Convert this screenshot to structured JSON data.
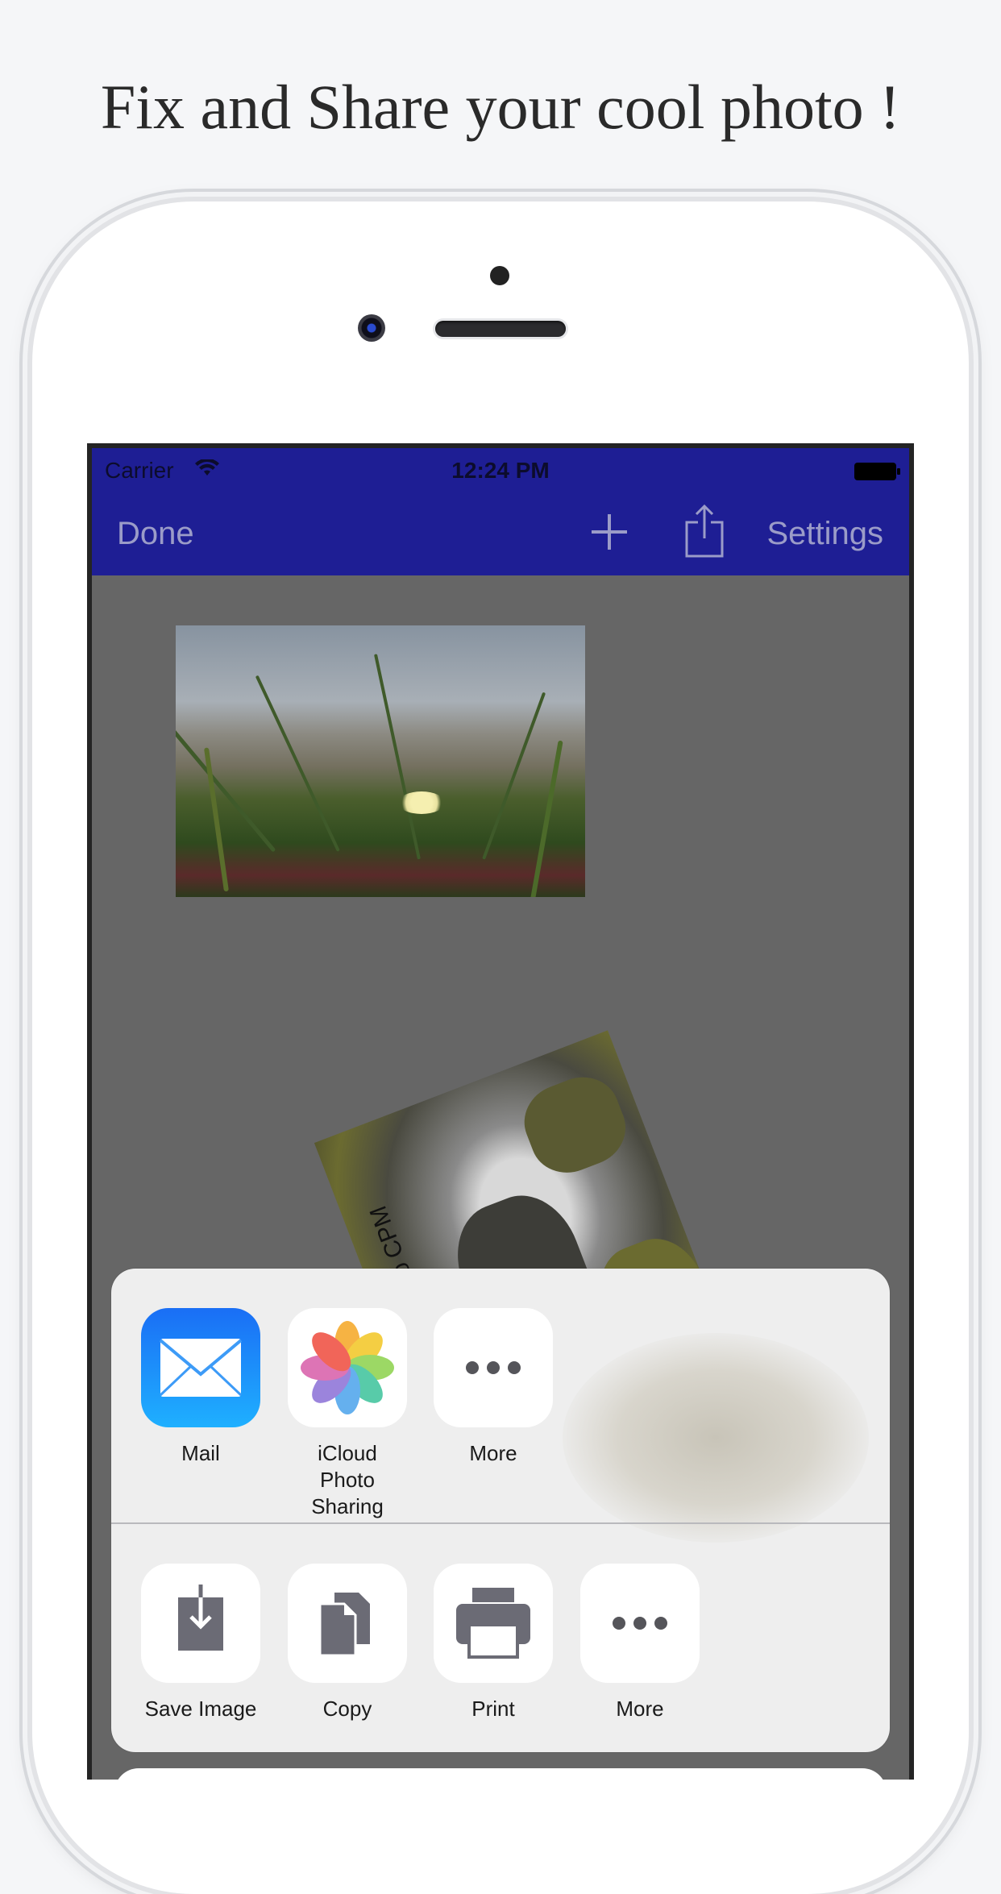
{
  "headline": "Fix and Share your cool photo !",
  "status_bar": {
    "carrier": "Carrier",
    "time": "12:24 PM"
  },
  "navbar": {
    "done_label": "Done",
    "settings_label": "Settings"
  },
  "photo_caption": "come To CPM",
  "share_sheet": {
    "top_row": [
      {
        "label": "Mail",
        "icon": "mail-icon"
      },
      {
        "label": "iCloud Photo\nSharing",
        "icon": "photos-icon"
      },
      {
        "label": "More",
        "icon": "more-icon"
      }
    ],
    "bottom_row": [
      {
        "label": "Save Image",
        "icon": "save-image-icon"
      },
      {
        "label": "Copy",
        "icon": "copy-icon"
      },
      {
        "label": "Print",
        "icon": "print-icon"
      },
      {
        "label": "More",
        "icon": "more-icon"
      }
    ]
  },
  "colors": {
    "navbar": "#1e1e94",
    "nav_text": "#9b9cc8",
    "canvas": "#666666",
    "sheet": "#eeeeee"
  }
}
